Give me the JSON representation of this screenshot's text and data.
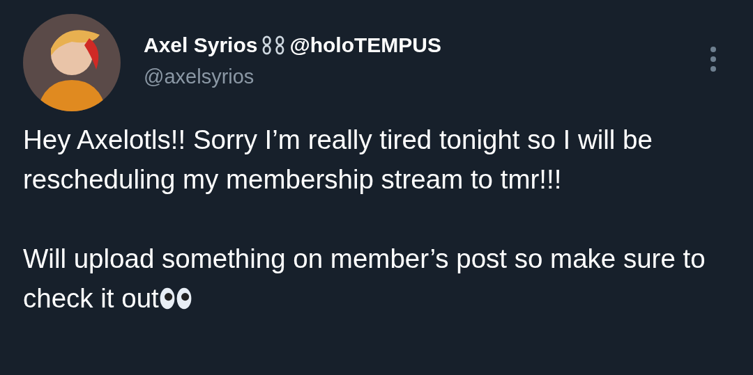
{
  "author": {
    "name": "Axel Syrios",
    "handle_in_name": "@holoTEMPUS",
    "username": "@axelsyrios"
  },
  "tweet": {
    "paragraphs": [
      "Hey Axelotls!! Sorry I’m really tired tonight so I will be rescheduling my membership stream to tmr!!!",
      "Will upload something on member’s post so make sure to check it out"
    ]
  }
}
